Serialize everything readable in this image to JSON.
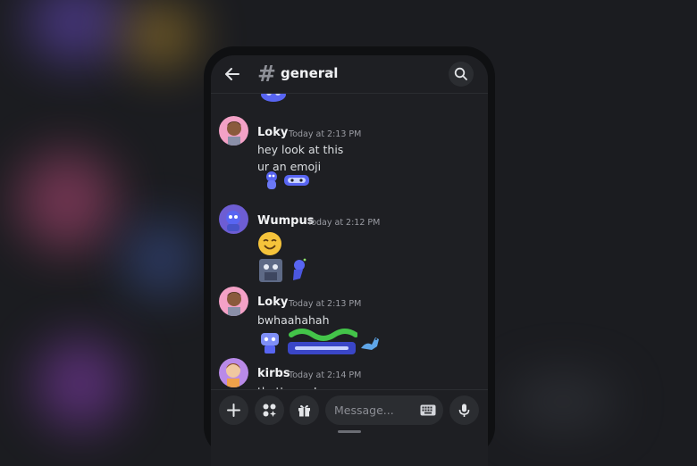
{
  "header": {
    "channel_hash": "#",
    "channel_name": "general",
    "chevron": "›"
  },
  "messages": [
    {
      "user": "Loky",
      "time": "Today at 2:13 PM",
      "lines": [
        "hey look at this",
        "ur an emoji"
      ]
    },
    {
      "user": "Wumpus",
      "time": "Today at 2:12 PM",
      "lines": []
    },
    {
      "user": "Loky",
      "time": "Today at 2:13 PM",
      "lines": [
        "bwhaahahah"
      ]
    },
    {
      "user": "kirbs",
      "time": "Today at 2:14 PM",
      "lines": [
        "that's you!"
      ]
    }
  ],
  "composer": {
    "placeholder": "Message..."
  },
  "icons": [
    "back-arrow-icon",
    "hash-icon",
    "search-icon",
    "plus-icon",
    "apps-icon",
    "gift-icon",
    "keyboard-icon",
    "microphone-icon"
  ],
  "colors": {
    "background": "#1e1f23",
    "accent": "#5865f2",
    "text": "#dbdee1"
  }
}
